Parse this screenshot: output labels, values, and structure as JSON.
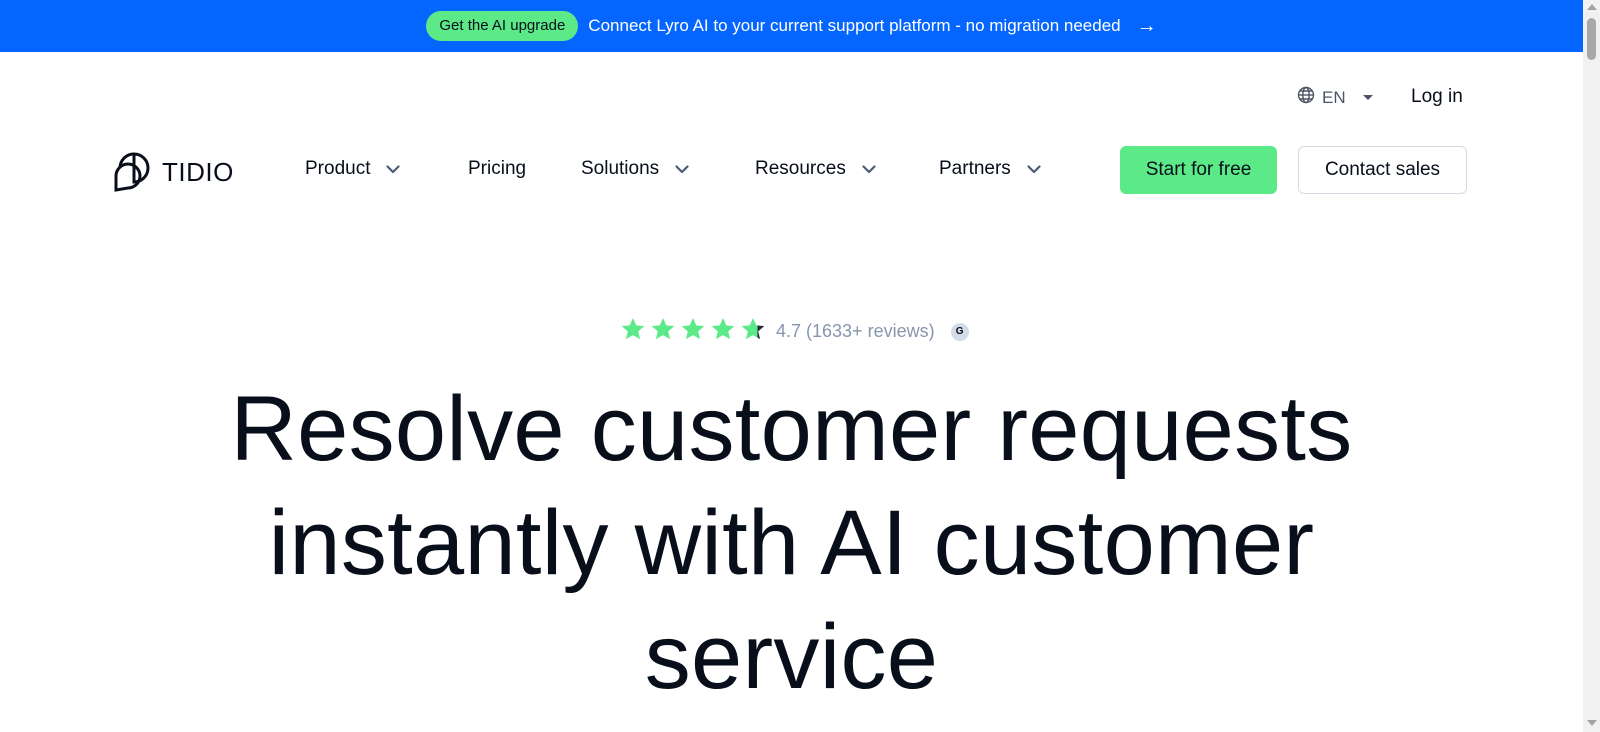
{
  "banner": {
    "badge": "Get the AI upgrade",
    "text": "Connect Lyro AI to your current support platform - no migration needed",
    "arrow": "→"
  },
  "topbar": {
    "language": "EN",
    "login": "Log in"
  },
  "logo": {
    "word": "TIDIO"
  },
  "nav": {
    "product": "Product",
    "pricing": "Pricing",
    "solutions": "Solutions",
    "resources": "Resources",
    "partners": "Partners"
  },
  "cta": {
    "start": "Start for free",
    "contact": "Contact sales"
  },
  "rating": {
    "stars": 4.7,
    "text": "4.7 (1633+ reviews)",
    "badge": "G"
  },
  "hero": {
    "headline": "Resolve customer requests instantly with AI customer service"
  },
  "colors": {
    "banner": "#0566ff",
    "accent_green": "#5ce987",
    "text_dark": "#080f1a",
    "muted": "#8796af"
  },
  "icons": [
    "globe-icon",
    "caret-down-icon",
    "chevron-down-icon",
    "star-icon",
    "arrow-right-icon",
    "tidio-logo-icon"
  ]
}
